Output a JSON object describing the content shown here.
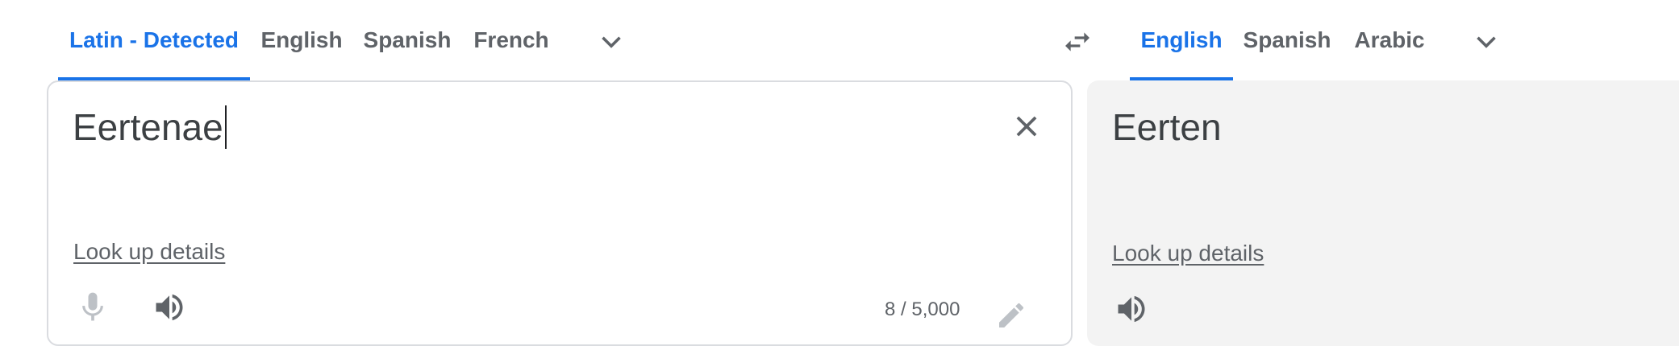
{
  "source_langs": {
    "tabs": [
      {
        "label": "Latin - Detected",
        "active": true
      },
      {
        "label": "English",
        "active": false
      },
      {
        "label": "Spanish",
        "active": false
      },
      {
        "label": "French",
        "active": false
      }
    ],
    "more_icon": "chevron-down-icon"
  },
  "swap_icon": "swap-horiz-icon",
  "target_langs": {
    "tabs": [
      {
        "label": "English",
        "active": true
      },
      {
        "label": "Spanish",
        "active": false
      },
      {
        "label": "Arabic",
        "active": false
      }
    ],
    "more_icon": "chevron-down-icon"
  },
  "source": {
    "text": "Eertenae",
    "lookup_label": "Look up details",
    "char_count": "8 / 5,000",
    "icons": [
      "mic-icon",
      "speaker-icon",
      "clear-icon",
      "pencil-icon"
    ]
  },
  "target": {
    "text": "Eerten",
    "lookup_label": "Look up details",
    "icons": [
      "speaker-icon"
    ]
  },
  "colors": {
    "accent": "#1a73e8",
    "text": "#3c4043",
    "muted": "#5f6368",
    "border": "#dadce0",
    "target_bg": "#f3f3f3"
  }
}
